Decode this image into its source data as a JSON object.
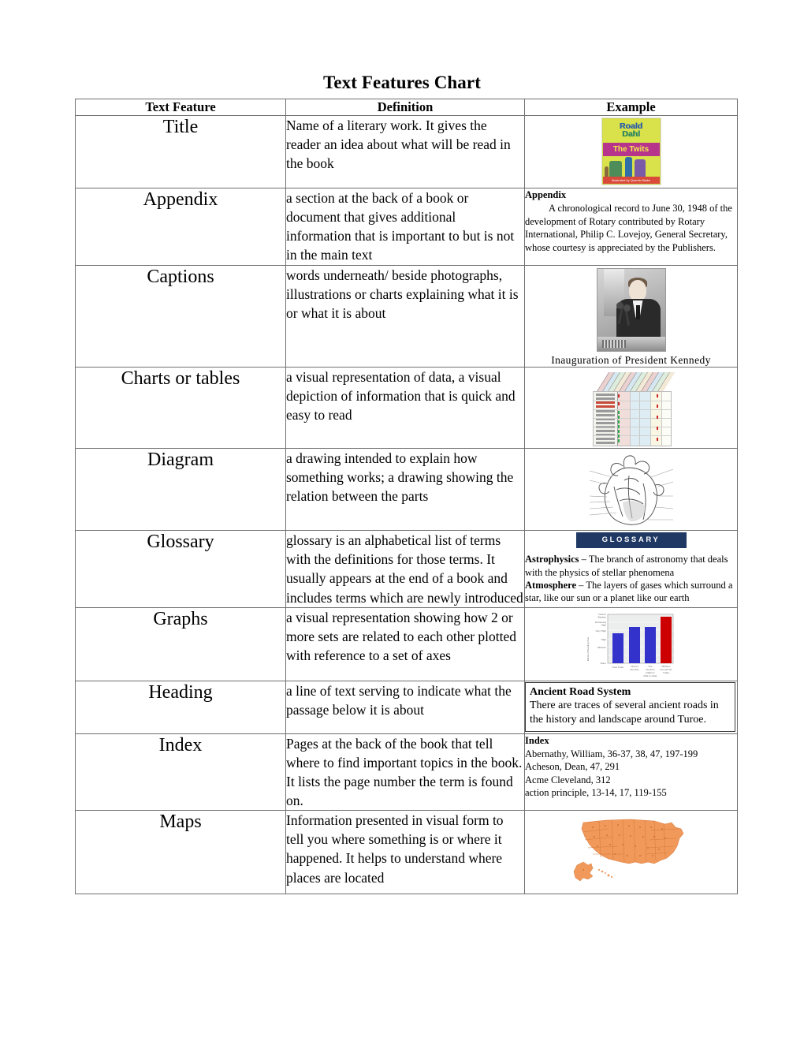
{
  "document": {
    "title": "Text Features Chart"
  },
  "table": {
    "columns": [
      "Text Feature",
      "Definition",
      "Example"
    ],
    "rows": [
      {
        "feature": "Title",
        "definition": "Name of a literary work. It gives the reader an idea about what will be read in the book",
        "example_type": "book-cover-image",
        "example": {
          "author_line1": "Roald",
          "author_line2": "Dahl",
          "book_title": "The Twits",
          "illustrator_credit": "Illustrated by Quentin Blake"
        }
      },
      {
        "feature": "Appendix",
        "definition": "a section at the back of a book or document that gives additional information that is important to but is not in the main text",
        "example_type": "text-block",
        "example": {
          "heading": "Appendix",
          "body": "A chronological record to June 30, 1948 of the development of Rotary contributed by Rotary International, Philip C. Lovejoy, General Secretary, whose courtesy is appreciated by the Publishers."
        }
      },
      {
        "feature": "Captions",
        "definition": "words underneath/ beside photographs, illustrations or charts explaining what it is or what it is about",
        "example_type": "photo-with-caption",
        "example": {
          "caption": "Inauguration  of  President Kennedy"
        }
      },
      {
        "feature": "Charts or tables",
        "definition": " a visual representation of data, a visual depiction of information that is quick and easy to read",
        "example_type": "spreadsheet-thumbnail",
        "example": {}
      },
      {
        "feature": "Diagram",
        "definition": "a drawing intended to explain how something works; a drawing showing the relation between the parts",
        "example_type": "heart-diagram",
        "example": {}
      },
      {
        "feature": "Glossary",
        "definition": "glossary is an alphabetical list of terms with the definitions for those terms. It usually appears at the end of a book and includes terms which are newly introduced",
        "example_type": "glossary-block",
        "example": {
          "banner": "GLOSSARY",
          "entries": [
            {
              "term": "Astrophysics",
              "dash": " – ",
              "text": "The branch of astronomy that deals with the physics of stellar phenomena"
            },
            {
              "term": "Atmosphere",
              "dash": " – ",
              "text": "The layers of gases which surround a star, like our sun or a planet like our earth"
            }
          ]
        }
      },
      {
        "feature": "Graphs",
        "definition": "a visual representation showing how 2 or more sets are related to each other plotted with reference to a set of axes",
        "example_type": "bar-chart",
        "example": {}
      },
      {
        "feature": "Heading",
        "definition": "a line of text serving to indicate what the passage below it is about",
        "example_type": "heading-block",
        "example": {
          "heading": "Ancient Road System",
          "body": "There are traces of several ancient roads in the history and landscape around Turoe."
        }
      },
      {
        "feature": "Index",
        "definition": "Pages at the back of the book that tell where to find important topics in the book. It lists the page number the term is found on.",
        "example_type": "index-block",
        "example": {
          "heading": "Index",
          "entries": [
            "Abernathy, William, 36-37, 38, 47, 197-199",
            "Acheson, Dean, 47, 291",
            "Acme Cleveland, 312",
            "action principle, 13-14, 17, 119-155"
          ]
        }
      },
      {
        "feature": "Maps",
        "definition": "Information presented in visual form to tell you where something is or where it happened. It helps to understand where places are located",
        "example_type": "us-map",
        "example": {}
      }
    ]
  },
  "chart_data": {
    "type": "bar",
    "title": "",
    "xlabel": "",
    "ylabel": "Effects of Boarding Time",
    "categories": [
      "Foot Knee",
      "Airport Security",
      "Pre Anytime platform 24hr in class",
      "Whisper around CD Trade"
    ],
    "values": [
      4,
      5,
      5,
      6
    ],
    "ytick_labels": [
      "None",
      "Medium",
      "High",
      "Very High",
      "Extremely High",
      "Call for Backup"
    ],
    "ylim": [
      0,
      6
    ],
    "grid": true,
    "legend": "none",
    "bar_colors": [
      "#3333cc",
      "#3333cc",
      "#3333cc",
      "#cc0000"
    ]
  },
  "colors": {
    "glossary_banner": "#1f3864",
    "map_fill": "#f0995a",
    "map_stroke": "#d9793a",
    "bar_blue": "#3333cc",
    "bar_red": "#cc0000",
    "table_border": "#707070"
  }
}
